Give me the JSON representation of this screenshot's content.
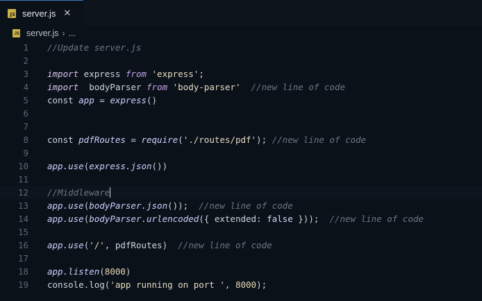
{
  "tab": {
    "icon": "js-file-icon",
    "label": "server.js",
    "close": "✕"
  },
  "breadcrumb": {
    "file": "server.js",
    "separator": "›",
    "more": "..."
  },
  "lines": [
    {
      "num": "1",
      "segs": [
        {
          "t": "//Update server.js",
          "c": "cm"
        }
      ]
    },
    {
      "num": "2",
      "segs": []
    },
    {
      "num": "3",
      "segs": [
        {
          "t": "import",
          "c": "kw-import"
        },
        {
          "t": " express ",
          "c": ""
        },
        {
          "t": "from",
          "c": "kw-from"
        },
        {
          "t": " 'express';",
          "c": "str"
        }
      ]
    },
    {
      "num": "4",
      "segs": [
        {
          "t": "import",
          "c": "kw-import"
        },
        {
          "t": "  bodyParser ",
          "c": ""
        },
        {
          "t": "from",
          "c": "kw-from"
        },
        {
          "t": " 'body-parser'",
          "c": "str"
        },
        {
          "t": "  //new line of code",
          "c": "cm"
        }
      ]
    },
    {
      "num": "5",
      "segs": [
        {
          "t": "const ",
          "c": ""
        },
        {
          "t": "app",
          "c": "fn"
        },
        {
          "t": " = ",
          "c": ""
        },
        {
          "t": "express",
          "c": "fn"
        },
        {
          "t": "()",
          "c": ""
        }
      ]
    },
    {
      "num": "6",
      "segs": []
    },
    {
      "num": "7",
      "segs": []
    },
    {
      "num": "8",
      "segs": [
        {
          "t": "const ",
          "c": ""
        },
        {
          "t": "pdfRoutes",
          "c": "fn"
        },
        {
          "t": " = ",
          "c": ""
        },
        {
          "t": "require",
          "c": "fn"
        },
        {
          "t": "(",
          "c": ""
        },
        {
          "t": "'./routes/pdf'",
          "c": "str"
        },
        {
          "t": "); ",
          "c": ""
        },
        {
          "t": "//new line of code",
          "c": "cm"
        }
      ]
    },
    {
      "num": "9",
      "segs": []
    },
    {
      "num": "10",
      "segs": [
        {
          "t": "app.use",
          "c": "fn"
        },
        {
          "t": "(",
          "c": ""
        },
        {
          "t": "express.json",
          "c": "fn"
        },
        {
          "t": "())",
          "c": ""
        }
      ]
    },
    {
      "num": "11",
      "segs": []
    },
    {
      "num": "12",
      "segs": [
        {
          "t": "//Middleware",
          "c": "cm"
        }
      ],
      "active": true,
      "cursor": true
    },
    {
      "num": "13",
      "segs": [
        {
          "t": "app.use",
          "c": "fn"
        },
        {
          "t": "(",
          "c": ""
        },
        {
          "t": "bodyParser.json",
          "c": "fn"
        },
        {
          "t": "());  ",
          "c": ""
        },
        {
          "t": "//new line of code",
          "c": "cm"
        }
      ]
    },
    {
      "num": "14",
      "segs": [
        {
          "t": "app.use",
          "c": "fn"
        },
        {
          "t": "(",
          "c": ""
        },
        {
          "t": "bodyParser.urlencoded",
          "c": "fn"
        },
        {
          "t": "({ extended: ",
          "c": ""
        },
        {
          "t": "false",
          "c": "var"
        },
        {
          "t": " }));  ",
          "c": ""
        },
        {
          "t": "//new line of code",
          "c": "cm"
        }
      ]
    },
    {
      "num": "15",
      "segs": []
    },
    {
      "num": "16",
      "segs": [
        {
          "t": "app.use",
          "c": "fn"
        },
        {
          "t": "(",
          "c": ""
        },
        {
          "t": "'/'",
          "c": "str"
        },
        {
          "t": ", pdfRoutes)  ",
          "c": ""
        },
        {
          "t": "//new line of code",
          "c": "cm"
        }
      ]
    },
    {
      "num": "17",
      "segs": []
    },
    {
      "num": "18",
      "segs": [
        {
          "t": "app.listen",
          "c": "fn"
        },
        {
          "t": "(",
          "c": ""
        },
        {
          "t": "8000",
          "c": "num"
        },
        {
          "t": ")",
          "c": ""
        }
      ]
    },
    {
      "num": "19",
      "segs": [
        {
          "t": "console.log(",
          "c": ""
        },
        {
          "t": "'app running on port '",
          "c": "str"
        },
        {
          "t": ", ",
          "c": ""
        },
        {
          "t": "8000",
          "c": "num"
        },
        {
          "t": ");",
          "c": ""
        }
      ]
    }
  ]
}
